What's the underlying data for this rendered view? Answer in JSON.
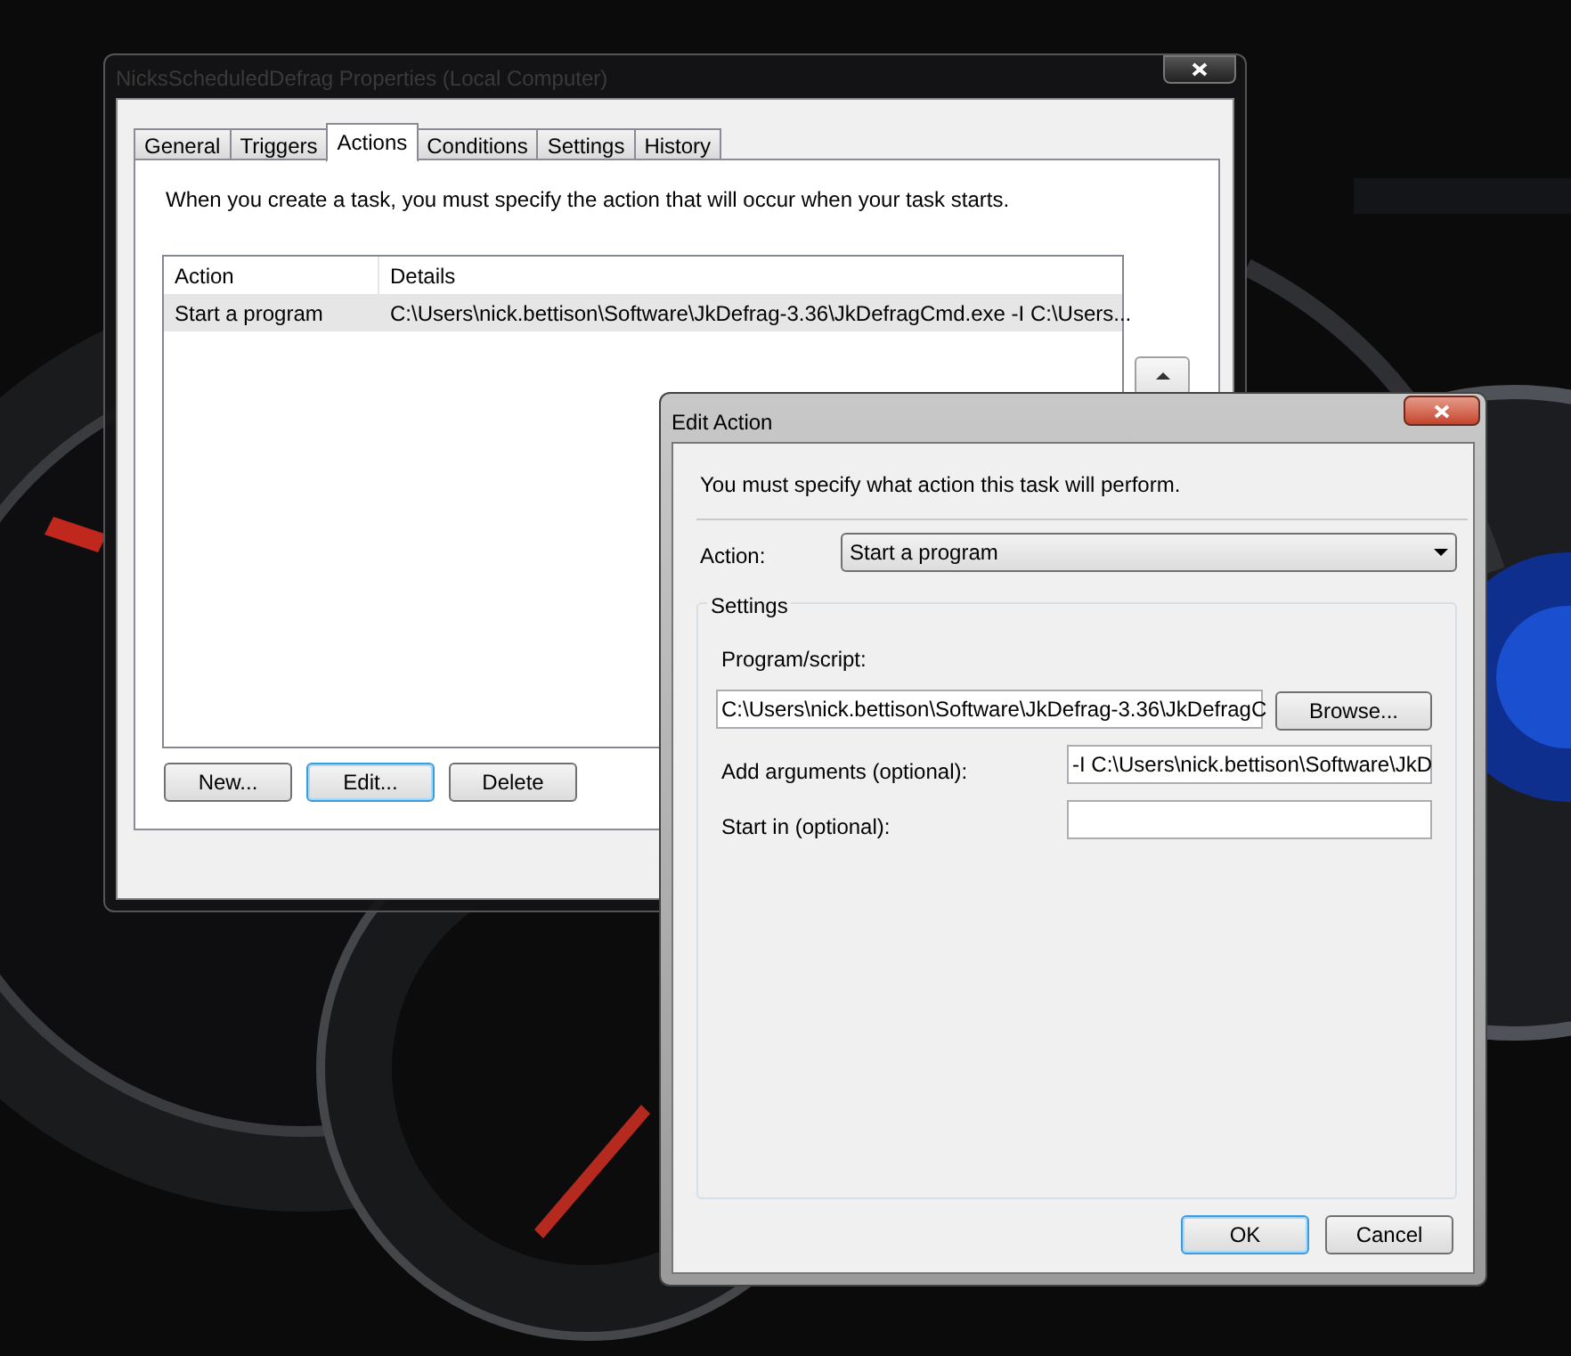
{
  "properties_window": {
    "title": "NicksScheduledDefrag Properties (Local Computer)",
    "tabs": [
      {
        "label": "General",
        "selected": false
      },
      {
        "label": "Triggers",
        "selected": false
      },
      {
        "label": "Actions",
        "selected": true
      },
      {
        "label": "Conditions",
        "selected": false
      },
      {
        "label": "Settings",
        "selected": false
      },
      {
        "label": "History",
        "selected": false
      }
    ],
    "description": "When you create a task, you must specify the action that will occur when your task starts.",
    "actions_table": {
      "columns": [
        "Action",
        "Details"
      ],
      "rows": [
        {
          "cells": [
            "Start a program",
            "C:\\Users\\nick.bettison\\Software\\JkDefrag-3.36\\JkDefragCmd.exe -I C:\\Users..."
          ],
          "selected": true
        }
      ]
    },
    "buttons": [
      {
        "label": "New...",
        "focused": false
      },
      {
        "label": "Edit...",
        "focused": true
      },
      {
        "label": "Delete",
        "focused": false
      }
    ]
  },
  "edit_dialog": {
    "title": "Edit Action",
    "instruction": "You must specify what action this task will perform.",
    "action_label": "Action:",
    "action_value": "Start a program",
    "settings_legend": "Settings",
    "program_label": "Program/script:",
    "program_value": "C:\\Users\\nick.bettison\\Software\\JkDefrag-3.36\\JkDefragC",
    "browse_button": "Browse...",
    "arguments_label": "Add arguments (optional):",
    "arguments_value": "-I C:\\Users\\nick.bettison\\Software\\JkD",
    "start_in_label": "Start in (optional):",
    "buttons": [
      {
        "label": "OK",
        "focused": true
      },
      {
        "label": "Cancel",
        "focused": false
      }
    ]
  }
}
